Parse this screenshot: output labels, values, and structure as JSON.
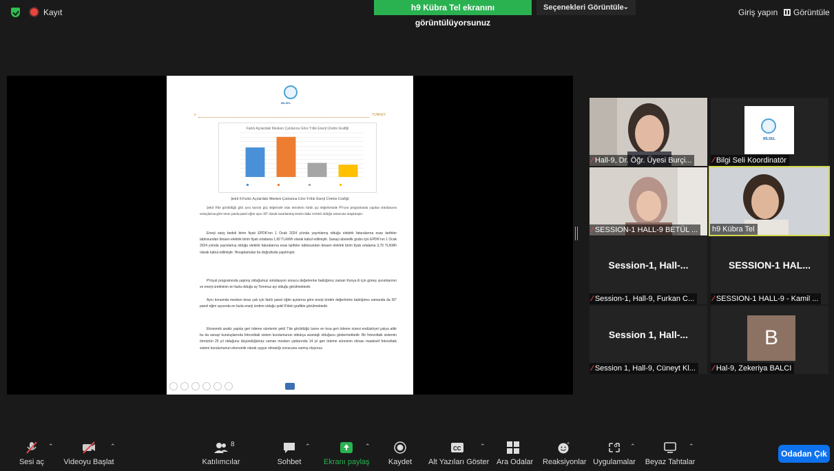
{
  "topbar": {
    "record_label": "Kayıt",
    "share_banner": "h9 Kübra Tel ekranını görüntülüyorsunuz",
    "view_options": "Seçenekleri Görüntüle",
    "sign_in": "Giriş yapın",
    "view": "Görüntüle"
  },
  "document": {
    "logo_text": "BİLSEL",
    "header_left": "I°",
    "header_right": "TURKEY",
    "chart_title": "Farklı Açılardaki Mesken Çatılarına Göre Yıllık Enerji Üretim Grafiği",
    "caption": "Şekil 8.Farklı Açılardaki Mesken Çatılarına Göre Yıllık Enerji Üretim Grafiği",
    "paragraphs": [
      "Şekil 8'de görüldüğü gibi aynı kurulu güç değerinde olan tesislerin farklı açı değerlerinde PVsyst programında yapılan simülasyon sonuçlarına göre teras çatıda panel eğim açısı 30° olarak tasarlanmış tesisin daha verimli olduğu sonucuna ulaşılmıştır.",
      "Enerji satış bedeli birim fiyatı EPDK'nın 1 Ocak 2024 yılında yayınlamış olduğu elektrik faturalarına esas tarifeler tablosundan binaen elektrik birim fiyatı ortalama 1,60 TL/kWh olarak kabul edilmiştir. Sanayi abonelik grubu için EPDK'nın 1 Ocak 2024 yılında yayınlamış olduğu elektrik faturalarına esas tarifeler tablosundan binaen elektrik birim fiyatı ortalama 3,70 TL/kWh olarak kabul edilmiştir. Hesaplamalar bu doğrultuda yapılmıştır.",
      "PVsyst programında yapmış olduğumuz simülasyon sonucu değerlerine baktığımız zaman Konya ili için güneş ışınımlarının ve enerji üretiminin en fazla olduğu ay Temmuz ayı olduğu görülmektedir.",
      "Aynı konumda mesken teras çatı için farklı panel eğim açılarına göre enerji üretim değerlerine baktığımız zamanda da 30° panel eğim açısında en fazla enerji üretimi olduğu şekil 8'deki grafikte görülmektedir.",
      "Ekonomik analiz yapılıp geri ödeme sürelerini şekil 7'de görüldüğü üzere en kısa geri ödeme süresi endüstriyel çatıya aittir bu da sanayi kuruluşlarında fotovoltaik sistem kurulumunun oldukça avantajlı olduğunu göstermektedir. Bir fotovoltaik sistemin ömrünün 25 yıl olduğunu düşündüğümüz zaman mesken çatılarında 14 yıl geri ödeme süresinin olması maalesef fotovoltaik sistem kurulumunun ekonomik olarak uygun olmadığı sonucuna varmış oluyoruz."
    ]
  },
  "chart_data": {
    "type": "bar",
    "title": "Farklı Açılardaki Mesken Çatılarına Göre Yıllık Enerji Üretim Grafiği",
    "categories": [
      "A",
      "B",
      "C",
      "D"
    ],
    "values": [
      67000,
      91000,
      32000,
      28000
    ],
    "ylim": [
      0,
      100000
    ],
    "grid": true,
    "legend": "bottom",
    "colors": [
      "#4a90d9",
      "#ed7d31",
      "#a5a5a5",
      "#ffc000"
    ]
  },
  "participants": [
    {
      "name": "Hall-9, Dr. Öğr. Üyesi Burçi...",
      "type": "video-woman1",
      "muted": true
    },
    {
      "name": "Bilgi Seli Koordinatör",
      "type": "logo",
      "muted": true
    },
    {
      "name": "SESSION-1 HALL-9 BETÜL ...",
      "type": "video-woman2",
      "muted": true
    },
    {
      "name": "h9 Kübra Tel",
      "type": "video-woman3",
      "muted": false,
      "active": true
    },
    {
      "name": "Session-1, Hall-9, Furkan C...",
      "big": "Session-1,  Hall-...",
      "muted": true
    },
    {
      "name": "SESSION-1 HALL-9 - Kamil ...",
      "big": "SESSION-1  HAL...",
      "muted": true
    },
    {
      "name": "Session 1, Hall-9, Cüneyt Kl...",
      "big": "Session  1,  Hall-...",
      "muted": true
    },
    {
      "name": "Hal-9, Zekeriya BALCI",
      "avatar": "B",
      "muted": true
    }
  ],
  "toolbar": {
    "unmute": "Sesi aç",
    "start_video": "Videoyu Başlat",
    "participants": "Katılımcılar",
    "participants_count": "8",
    "chat": "Sohbet",
    "share_screen": "Ekranı paylaş",
    "record": "Kaydet",
    "captions": "Alt Yazıları Göster",
    "breakout": "Ara Odalar",
    "reactions": "Reaksiyonlar",
    "apps": "Uygulamalar",
    "whiteboards": "Beyaz Tahtalar",
    "leave": "Odadan Çık"
  }
}
